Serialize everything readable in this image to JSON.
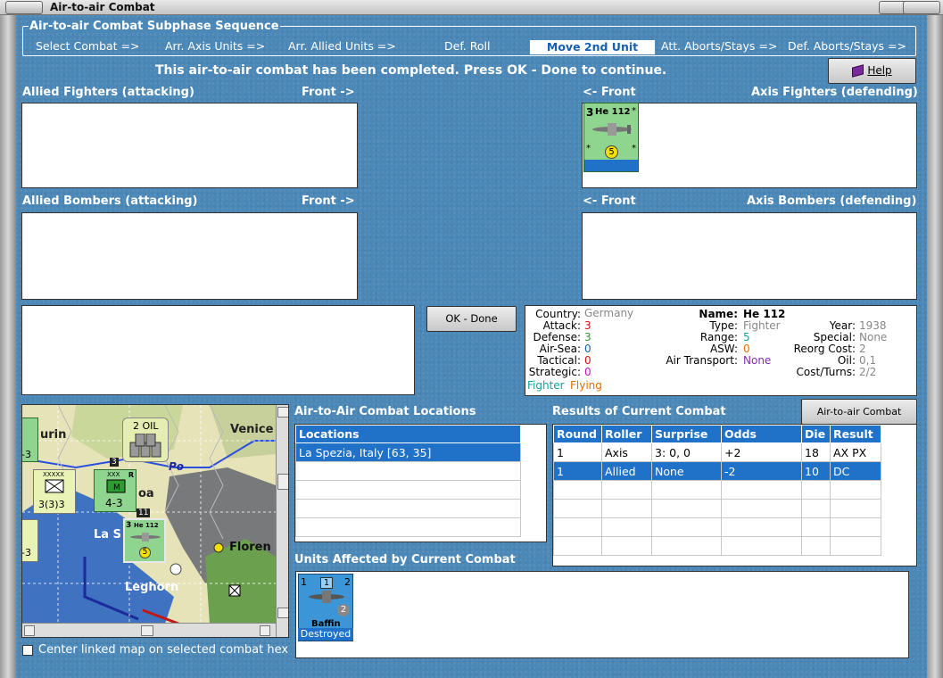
{
  "window": {
    "title": "Air-to-air Combat"
  },
  "sequence": {
    "legend": "Air-to-air Combat Subphase Sequence",
    "steps": [
      "Select Combat =>",
      "Arr. Axis Units =>",
      "Arr. Allied Units =>",
      "Def. Roll",
      "Move 2nd Unit",
      "Att. Aborts/Stays =>",
      "Def. Aborts/Stays =>"
    ],
    "active_index": 4
  },
  "status_message": "This air-to-air combat has been completed.  Press OK - Done to continue.",
  "help_button": "Help",
  "ok_button": "OK - Done",
  "headers": {
    "allied_fighters": "Allied Fighters (attacking)",
    "allied_bombers": "Allied Bombers (attacking)",
    "front_right": "Front ->",
    "front_left": "<- Front",
    "axis_fighters": "Axis Fighters (defending)",
    "axis_bombers": "Axis Bombers (defending)"
  },
  "axis_unit": {
    "name": "He 112",
    "left_top": "3",
    "value": "5",
    "star": "*"
  },
  "unit_info": {
    "country_label": "Country:",
    "country": "Germany",
    "attack_label": "Attack:",
    "attack": "3",
    "defense_label": "Defense:",
    "defense": "3",
    "airsea_label": "Air-Sea:",
    "airsea": "0",
    "tactical_label": "Tactical:",
    "tactical": "0",
    "strategic_label": "Strategic:",
    "strategic": "0",
    "status_fighter": "Fighter",
    "status_flying": "Flying",
    "name_label": "Name:",
    "name": "He 112",
    "type_label": "Type:",
    "type": "Fighter",
    "range_label": "Range:",
    "range": "5",
    "asw_label": "ASW:",
    "asw": "0",
    "airtransport_label": "Air Transport:",
    "airtransport": "None",
    "year_label": "Year:",
    "year": "1938",
    "special_label": "Special:",
    "special": "None",
    "reorg_label": "Reorg Cost:",
    "reorg": "2",
    "oil_label": "Oil:",
    "oil": "0,1",
    "costturns_label": "Cost/Turns:",
    "costturns": "2/2"
  },
  "map": {
    "labels": {
      "turin": "urin",
      "venice": "Venice",
      "po": "Po",
      "genoa": "oa",
      "laspezia": "La S",
      "florence": "Floren",
      "leghorn": "Leghorn",
      "oil": "2 OIL"
    },
    "counters": {
      "army_top": "XXXXX",
      "army_val": "3(3)3",
      "corps_top": "XXX",
      "corps_val": "4-3",
      "eleven": "11",
      "three": "3",
      "r": "R",
      "left_val1": "-3",
      "left_val2": "-3"
    }
  },
  "center_map_label": "Center linked map on selected combat hex",
  "locations": {
    "title": "Air-to-Air Combat Locations",
    "header": "Locations",
    "rows": [
      "La Spezia, Italy [63, 35]"
    ]
  },
  "results": {
    "title": "Results of Current Combat",
    "chart_button": "Air-to-air Combat Chart",
    "headers": [
      "Round",
      "Roller",
      "Surprise",
      "Odds",
      "Die",
      "Result"
    ],
    "rows": [
      [
        "1",
        "Axis",
        "3: 0, 0",
        "+2",
        "18",
        "AX PX"
      ],
      [
        "1",
        "Allied",
        "None",
        "-2",
        "10",
        "DC"
      ]
    ]
  },
  "affected": {
    "title": "Units Affected by Current Combat",
    "unit_name": "Baffin",
    "unit_status": "Destroyed",
    "tl": "1",
    "tr": "2",
    "mid": "1",
    "br": "2"
  },
  "colors": {
    "bg": "#4b88b8",
    "selection": "#1f72c8",
    "gray": "#888888",
    "green": "#2e9b2e",
    "orange": "#e07000",
    "red": "#d01010",
    "purple": "#8a2bb0",
    "fighter": "#14a0a0"
  }
}
